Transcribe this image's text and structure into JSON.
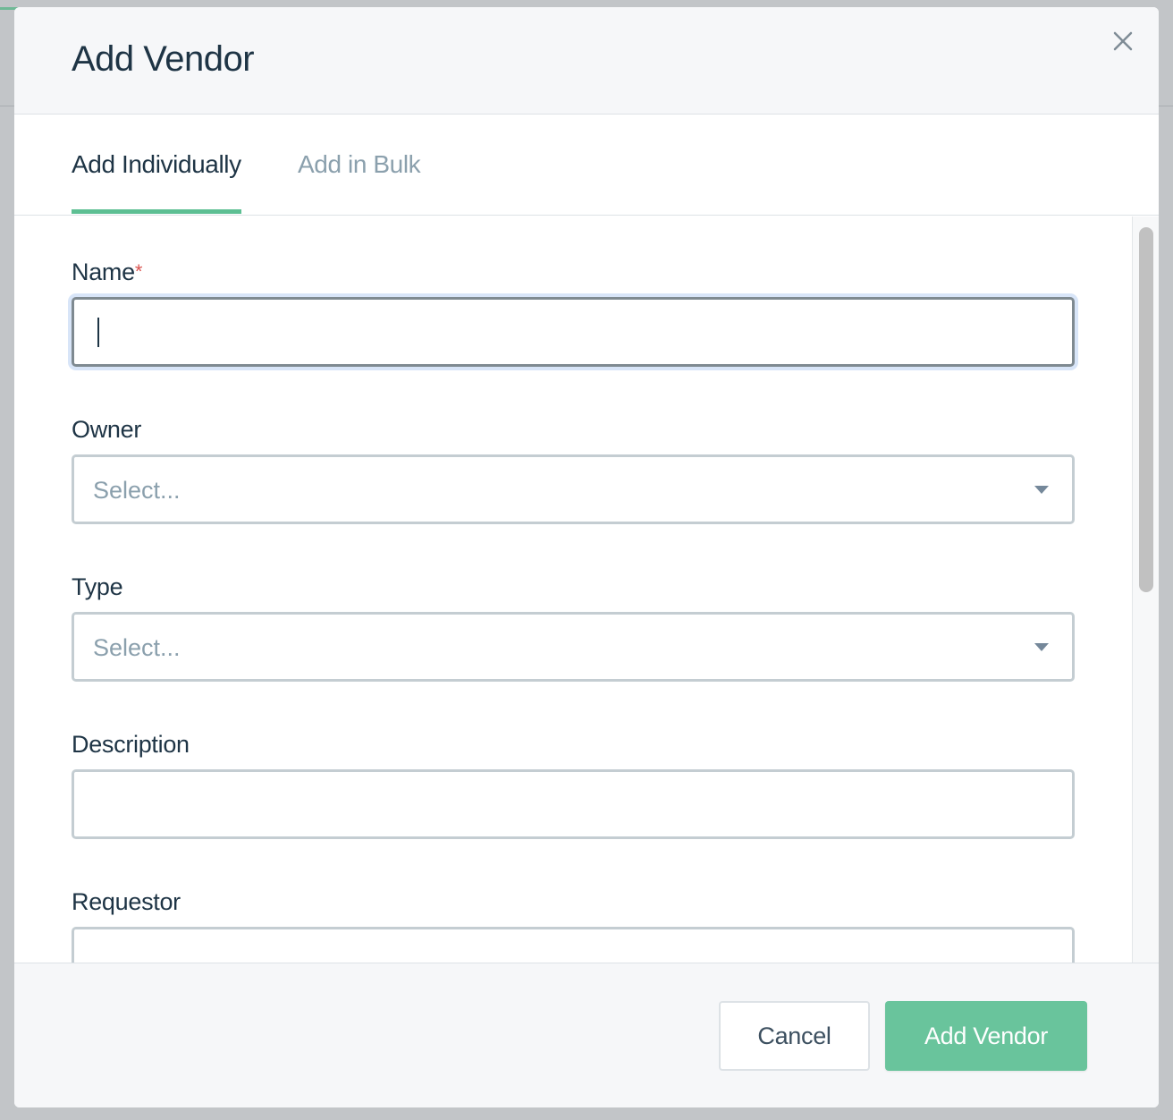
{
  "modal": {
    "title": "Add Vendor"
  },
  "tabs": [
    {
      "label": "Add Individually",
      "active": true
    },
    {
      "label": "Add in Bulk",
      "active": false
    }
  ],
  "form": {
    "name": {
      "label": "Name",
      "required_mark": "*",
      "value": ""
    },
    "owner": {
      "label": "Owner",
      "placeholder": "Select..."
    },
    "type": {
      "label": "Type",
      "placeholder": "Select..."
    },
    "description": {
      "label": "Description",
      "value": ""
    },
    "requestor": {
      "label": "Requestor",
      "value": ""
    }
  },
  "footer": {
    "cancel_label": "Cancel",
    "submit_label": "Add Vendor"
  },
  "colors": {
    "accent": "#69c49c",
    "tab_underline": "#5dbf93",
    "text_primary": "#1e3445",
    "text_muted": "#8ba0ad",
    "required": "#d9534f"
  },
  "icons": {
    "close": "close-icon",
    "dropdown": "chevron-down-icon"
  }
}
